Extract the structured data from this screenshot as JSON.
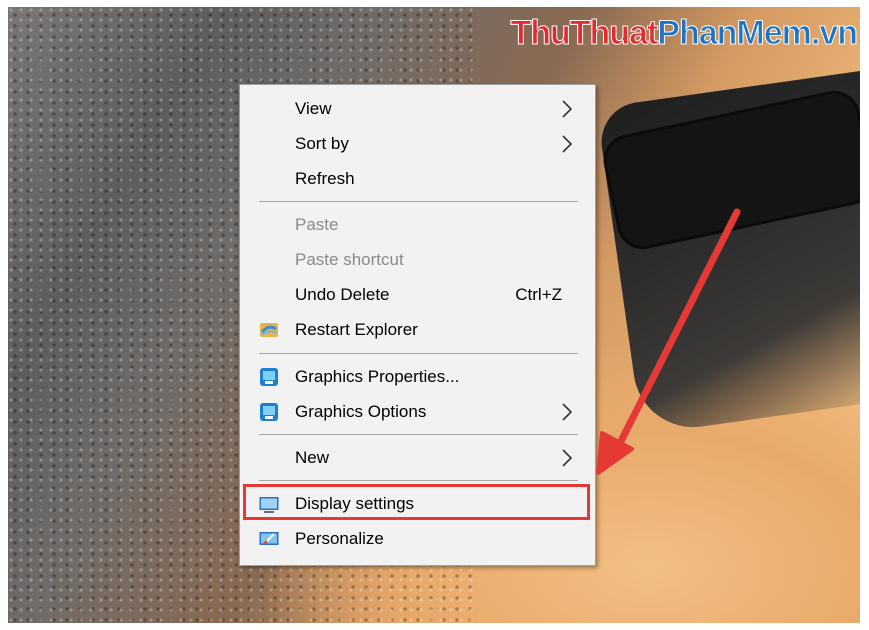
{
  "watermark": {
    "part1": "ThuThuat",
    "part2": "PhanMem.vn"
  },
  "menu": {
    "view": "View",
    "sort_by": "Sort by",
    "refresh": "Refresh",
    "paste": "Paste",
    "paste_shortcut": "Paste shortcut",
    "undo_delete": "Undo Delete",
    "undo_shortcut": "Ctrl+Z",
    "restart_explorer": "Restart Explorer",
    "graphics_properties": "Graphics Properties...",
    "graphics_options": "Graphics Options",
    "new": "New",
    "display_settings": "Display settings",
    "personalize": "Personalize"
  },
  "colors": {
    "highlight": "#e53935",
    "annotation_arrow": "#e53935",
    "menu_bg": "#f2f2f2"
  }
}
